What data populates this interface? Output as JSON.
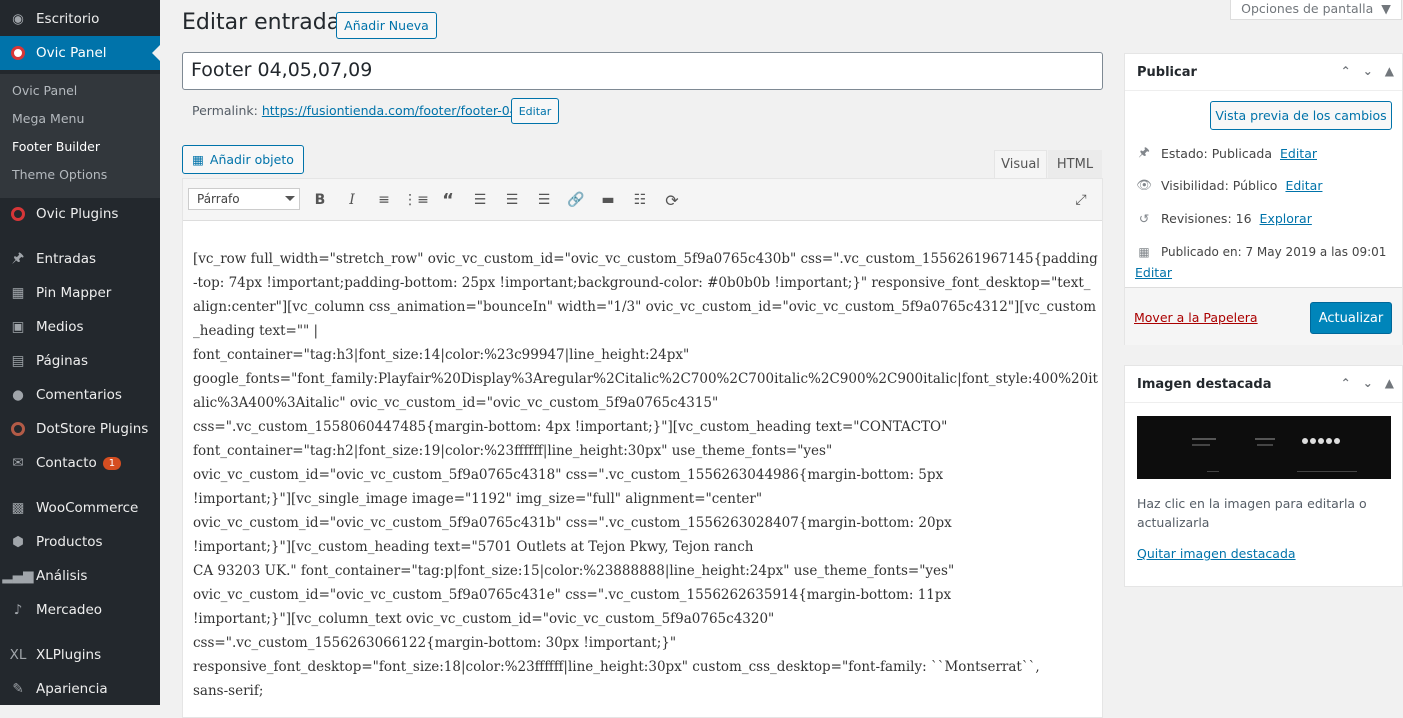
{
  "sidebar": {
    "items": [
      {
        "label": "Escritorio",
        "icon": "dashboard-icon"
      },
      {
        "label": "Ovic Panel",
        "icon": "ovic-icon"
      },
      {
        "label": "Ovic Plugins",
        "icon": "ovic-plugins-icon"
      },
      {
        "label": "Entradas",
        "icon": "pin-icon"
      },
      {
        "label": "Pin Mapper",
        "icon": "pin-mapper-icon"
      },
      {
        "label": "Medios",
        "icon": "media-icon"
      },
      {
        "label": "Páginas",
        "icon": "pages-icon"
      },
      {
        "label": "Comentarios",
        "icon": "comments-icon"
      },
      {
        "label": "DotStore Plugins",
        "icon": "dotstore-icon"
      },
      {
        "label": "Contacto",
        "icon": "mail-icon",
        "badge": "1"
      },
      {
        "label": "WooCommerce",
        "icon": "woocommerce-icon"
      },
      {
        "label": "Productos",
        "icon": "products-icon"
      },
      {
        "label": "Análisis",
        "icon": "analytics-icon"
      },
      {
        "label": "Mercadeo",
        "icon": "megaphone-icon"
      },
      {
        "label": "XLPlugins",
        "icon": "xl-icon"
      },
      {
        "label": "Apariencia",
        "icon": "brush-icon"
      }
    ],
    "submenu": [
      "Ovic Panel",
      "Mega Menu",
      "Footer Builder",
      "Theme Options"
    ]
  },
  "header": {
    "screen_options": "Opciones de pantalla",
    "title": "Editar entrada",
    "add_new": "Añadir Nueva"
  },
  "post": {
    "title": "Footer 04,05,07,09",
    "permalink_label": "Permalink:",
    "permalink_url": "https://fusiontienda.com/footer/footer-04/",
    "permalink_edit": "Editar"
  },
  "editor": {
    "add_object": "Añadir objeto",
    "tab_visual": "Visual",
    "tab_html": "HTML",
    "format": "Párrafo",
    "content": "[vc_row full_width=\"stretch_row\" ovic_vc_custom_id=\"ovic_vc_custom_5f9a0765c430b\" css=\".vc_custom_1556261967145{padding-top: 74px !important;padding-bottom: 25px !important;background-color: #0b0b0b !important;}\" responsive_font_desktop=\"text_align:center\"][vc_column css_animation=\"bounceIn\" width=\"1/3\" ovic_vc_custom_id=\"ovic_vc_custom_5f9a0765c4312\"][vc_custom_heading text=\"\" |\nfont_container=\"tag:h3|font_size:14|color:%23c99947|line_height:24px\"\ngoogle_fonts=\"font_family:Playfair%20Display%3Aregular%2Citalic%2C700%2C700italic%2C900%2C900italic|font_style:400%20italic%3A400%3Aitalic\" ovic_vc_custom_id=\"ovic_vc_custom_5f9a0765c4315\"\ncss=\".vc_custom_1558060447485{margin-bottom: 4px !important;}\"][vc_custom_heading text=\"CONTACTO\"\nfont_container=\"tag:h2|font_size:19|color:%23ffffff|line_height:30px\" use_theme_fonts=\"yes\"\novic_vc_custom_id=\"ovic_vc_custom_5f9a0765c4318\" css=\".vc_custom_1556263044986{margin-bottom: 5px\n!important;}\"][vc_single_image image=\"1192\" img_size=\"full\" alignment=\"center\"\novic_vc_custom_id=\"ovic_vc_custom_5f9a0765c431b\" css=\".vc_custom_1556263028407{margin-bottom: 20px\n!important;}\"][vc_custom_heading text=\"5701 Outlets at Tejon Pkwy, Tejon ranch\nCA 93203 UK.\" font_container=\"tag:p|font_size:15|color:%23888888|line_height:24px\" use_theme_fonts=\"yes\"\novic_vc_custom_id=\"ovic_vc_custom_5f9a0765c431e\" css=\".vc_custom_1556262635914{margin-bottom: 11px\n!important;}\"][vc_column_text ovic_vc_custom_id=\"ovic_vc_custom_5f9a0765c4320\"\ncss=\".vc_custom_1556263066122{margin-bottom: 30px !important;}\"\nresponsive_font_desktop=\"font_size:18|color:%23ffffff|line_height:30px\" custom_css_desktop=\"font-family: ``Montserrat``,\nsans-serif;"
  },
  "publish": {
    "title": "Publicar",
    "preview": "Vista previa de los cambios",
    "status_label": "Estado: Publicada",
    "status_edit": "Editar",
    "visibility_label": "Visibilidad: Público",
    "visibility_edit": "Editar",
    "revisions_label": "Revisiones: 16",
    "revisions_link": "Explorar",
    "published_label": "Publicado en: 7 May 2019 a las 09:01",
    "published_edit": "Editar",
    "trash": "Mover a la Papelera",
    "update": "Actualizar"
  },
  "featured": {
    "title": "Imagen destacada",
    "help": "Haz clic en la imagen para editarla o actualizarla",
    "remove": "Quitar imagen destacada"
  },
  "colors": {
    "sidebar": "#23282d",
    "accent": "#0073aa",
    "primary_button": "#0085ba"
  }
}
